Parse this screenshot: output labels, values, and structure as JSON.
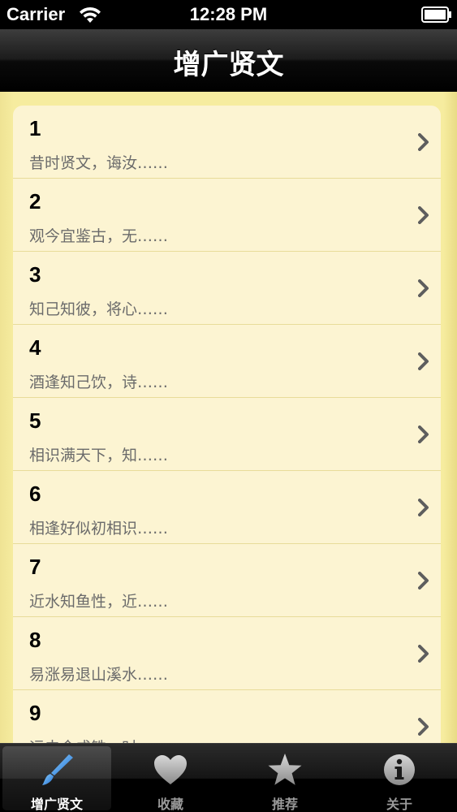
{
  "status_bar": {
    "carrier": "Carrier",
    "time": "12:28 PM"
  },
  "nav": {
    "title": "增广贤文"
  },
  "list": {
    "items": [
      {
        "number": "1",
        "text": "昔时贤文，诲汝……"
      },
      {
        "number": "2",
        "text": "观今宜鉴古，无……"
      },
      {
        "number": "3",
        "text": "知己知彼，将心……"
      },
      {
        "number": "4",
        "text": "酒逢知己饮，诗……"
      },
      {
        "number": "5",
        "text": "相识满天下，知……"
      },
      {
        "number": "6",
        "text": "相逢好似初相识……"
      },
      {
        "number": "7",
        "text": "近水知鱼性，近……"
      },
      {
        "number": "8",
        "text": "易涨易退山溪水……"
      },
      {
        "number": "9",
        "text": "运去金成铁，时……"
      }
    ]
  },
  "tabs": [
    {
      "label": "增广贤文",
      "icon": "paintbrush-icon",
      "selected": true
    },
    {
      "label": "收藏",
      "icon": "heart-icon",
      "selected": false
    },
    {
      "label": "推荐",
      "icon": "star-icon",
      "selected": false
    },
    {
      "label": "关于",
      "icon": "info-icon",
      "selected": false
    }
  ],
  "colors": {
    "accent_blue": "#4a90e0",
    "background_yellow": "#f4ea9c",
    "row_background": "#fcf4d2"
  }
}
